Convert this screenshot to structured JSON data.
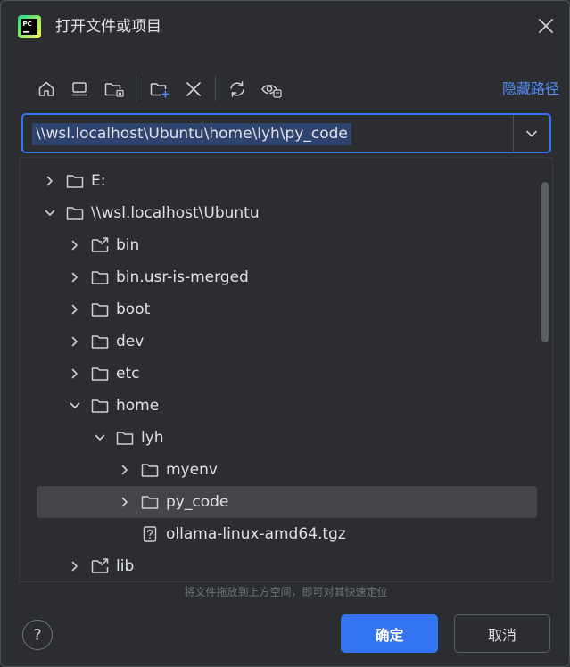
{
  "window": {
    "title": "打开文件或项目",
    "logo_text": "PC"
  },
  "toolbar": {
    "buttons": [
      {
        "name": "home-icon"
      },
      {
        "name": "desktop-icon"
      },
      {
        "name": "project-folder-icon"
      },
      {
        "name": "new-folder-icon"
      },
      {
        "name": "delete-icon"
      },
      {
        "name": "refresh-icon"
      },
      {
        "name": "show-hidden-icon"
      }
    ],
    "hide_path_label": "隐藏路径"
  },
  "path_field": {
    "value": "\\\\wsl.localhost\\Ubuntu\\home\\lyh\\py_code"
  },
  "tree": {
    "rows": [
      {
        "label": "E:",
        "expanded": false,
        "icon": "folder-icon"
      },
      {
        "label": "\\\\wsl.localhost\\Ubuntu",
        "expanded": true,
        "icon": "folder-icon"
      },
      {
        "label": "bin",
        "expanded": false,
        "icon": "folder-link-icon"
      },
      {
        "label": "bin.usr-is-merged",
        "expanded": false,
        "icon": "folder-icon"
      },
      {
        "label": "boot",
        "expanded": false,
        "icon": "folder-icon"
      },
      {
        "label": "dev",
        "expanded": false,
        "icon": "folder-icon"
      },
      {
        "label": "etc",
        "expanded": false,
        "icon": "folder-icon"
      },
      {
        "label": "home",
        "expanded": true,
        "icon": "folder-icon"
      },
      {
        "label": "lyh",
        "expanded": true,
        "icon": "folder-icon"
      },
      {
        "label": "myenv",
        "expanded": false,
        "icon": "folder-icon"
      },
      {
        "label": "py_code",
        "expanded": false,
        "icon": "folder-icon",
        "selected": true
      },
      {
        "label": "ollama-linux-amd64.tgz",
        "icon": "unknown-file-icon"
      },
      {
        "label": "lib",
        "expanded": false,
        "icon": "folder-link-icon"
      }
    ]
  },
  "hint_text": "将文件拖放到上方空间，即可对其快速定位",
  "footer": {
    "help_label": "?",
    "ok_label": "确定",
    "cancel_label": "取消"
  },
  "colors": {
    "accent": "#3574f0",
    "link": "#548af7",
    "background": "#2b2d30",
    "selection": "#43454a"
  }
}
